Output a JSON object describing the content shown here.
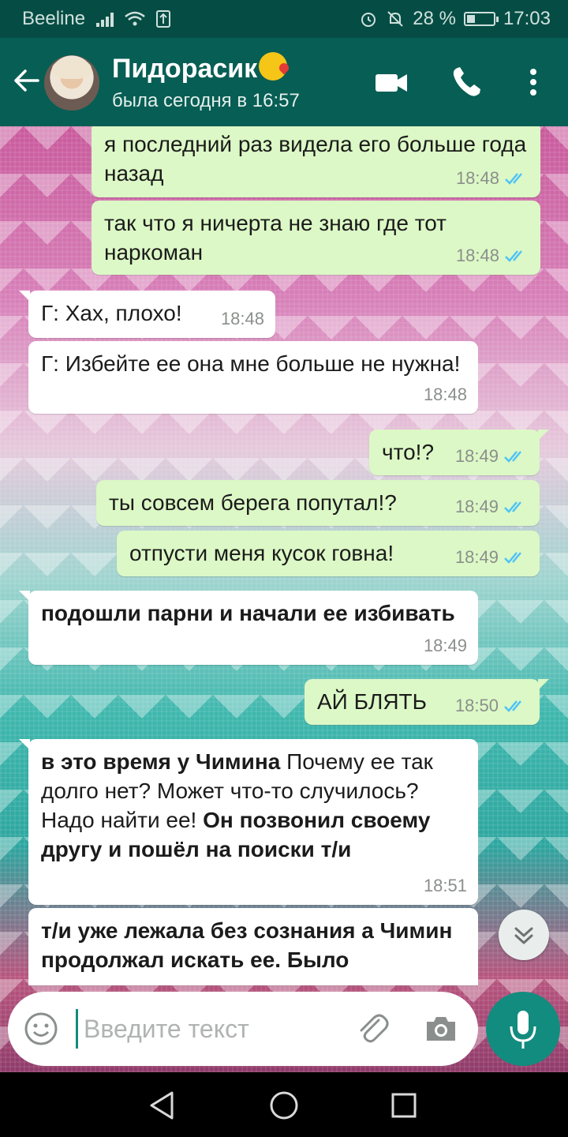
{
  "status": {
    "carrier": "Beeline",
    "battery_percent": "28 %",
    "time": "17:03",
    "colors": {
      "bar": "#054d44"
    }
  },
  "header": {
    "name": "Пидорасик",
    "status": "была сегодня в 16:57",
    "colors": {
      "bg": "#075e54"
    }
  },
  "messages": [
    {
      "dir": "out",
      "text": "я последний раз видела его больше года назад",
      "time": "18:48",
      "read": true
    },
    {
      "dir": "out",
      "text": "так что я ничерта не знаю где тот наркоман",
      "time": "18:48",
      "read": true
    },
    {
      "dir": "in",
      "text": "Г: Хах, плохо!",
      "time": "18:48"
    },
    {
      "dir": "in",
      "text": "Г: Избейте ее она мне больше не нужна!",
      "time": "18:48"
    },
    {
      "dir": "out",
      "text": "что!?",
      "time": "18:49",
      "read": true
    },
    {
      "dir": "out",
      "text": "ты совсем берега попутал!?",
      "time": "18:49",
      "read": true
    },
    {
      "dir": "out",
      "text": "отпусти меня кусок говна!",
      "time": "18:49",
      "read": true
    },
    {
      "dir": "in",
      "text": "подошли парни и начали ее избивать",
      "time": "18:49"
    },
    {
      "dir": "out",
      "text": "АЙ БЛЯТЬ",
      "time": "18:50",
      "read": true
    },
    {
      "dir": "in",
      "parts": [
        "в это время у Чимина",
        " Почему ее так долго нет? Может что-то случилось? Надо найти ее! ",
        "Он позвонил своему другу и пошёл на поиски т/и"
      ],
      "time": "18:51"
    },
    {
      "dir": "in",
      "text": "т/и уже лежала без сознания а Чимин продолжал искать ее. Было"
    }
  ],
  "composer": {
    "placeholder": "Введите текст"
  },
  "colors": {
    "accent": "#128c7e",
    "out_bubble": "#dcf8c6",
    "in_bubble": "#ffffff",
    "read_ticks": "#4fc3f7"
  }
}
